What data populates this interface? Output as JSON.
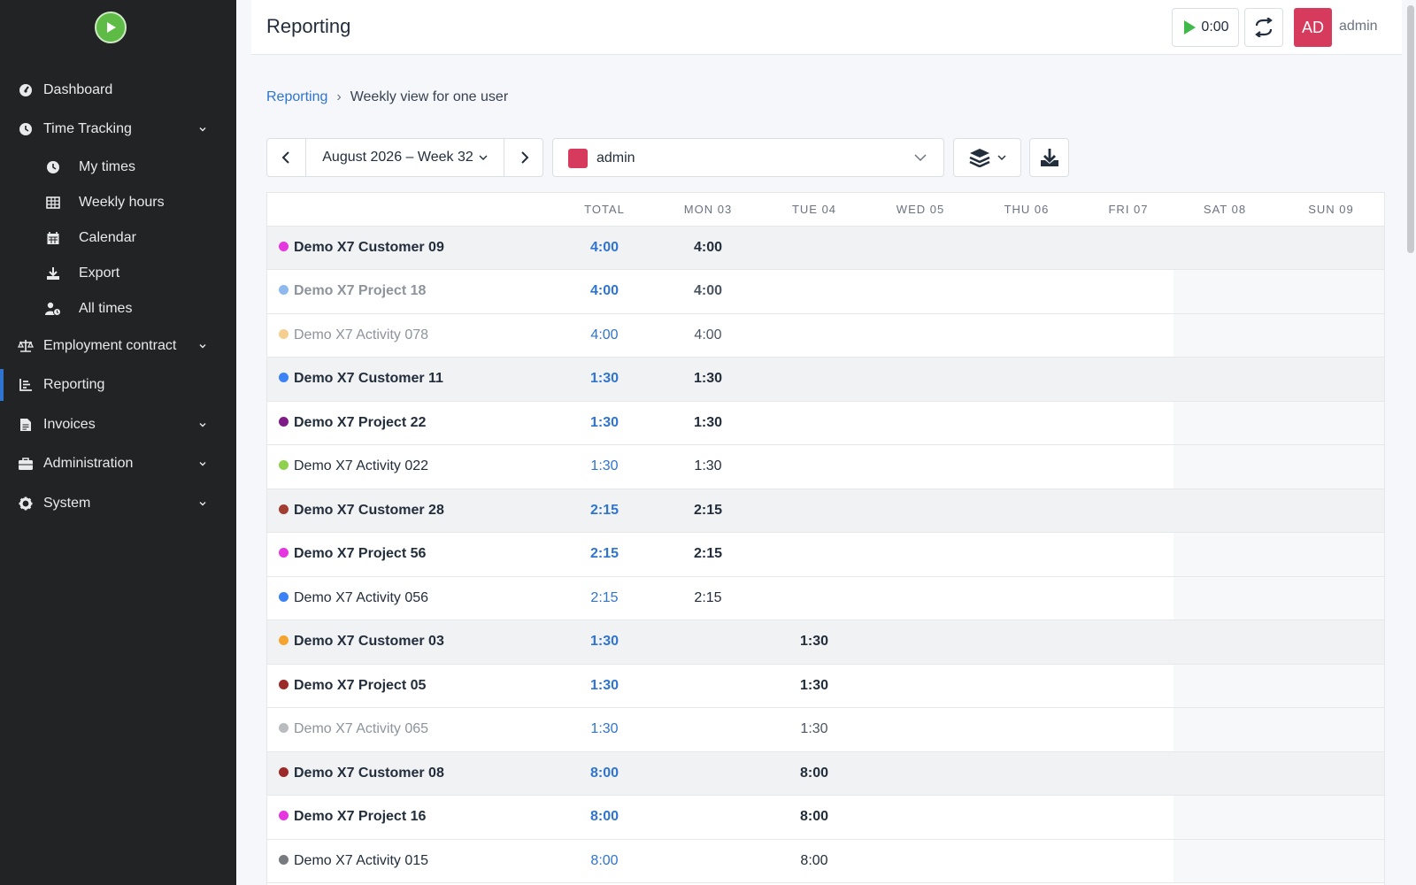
{
  "sidebar": {
    "items": [
      {
        "label": "Dashboard",
        "icon": "dashboard-icon",
        "has_chevron": false
      },
      {
        "label": "Time Tracking",
        "icon": "clock-icon",
        "has_chevron": true
      },
      {
        "label": "My times",
        "icon": "clock-icon",
        "sub": true
      },
      {
        "label": "Weekly hours",
        "icon": "grid-icon",
        "sub": true
      },
      {
        "label": "Calendar",
        "icon": "calendar-icon",
        "sub": true
      },
      {
        "label": "Export",
        "icon": "download-icon",
        "sub": true
      },
      {
        "label": "All times",
        "icon": "user-clock-icon",
        "sub": true
      },
      {
        "label": "Employment contract",
        "icon": "balance-scale-icon",
        "has_chevron": true
      },
      {
        "label": "Reporting",
        "icon": "chart-icon",
        "active": true
      },
      {
        "label": "Invoices",
        "icon": "file-invoice-icon",
        "has_chevron": true
      },
      {
        "label": "Administration",
        "icon": "toolbox-icon",
        "has_chevron": true
      },
      {
        "label": "System",
        "icon": "gear-icon",
        "has_chevron": true
      }
    ]
  },
  "header": {
    "title": "Reporting",
    "timer": "0:00",
    "avatar_initials": "AD",
    "user_name": "admin"
  },
  "breadcrumb": {
    "parent": "Reporting",
    "separator": "›",
    "current": "Weekly view for one user"
  },
  "toolbar": {
    "week_label": "August 2026 – Week 32",
    "user_select_value": "admin",
    "user_color": "#d63b5d"
  },
  "table": {
    "columns": [
      "",
      "TOTAL",
      "MON 03",
      "TUE 04",
      "WED 05",
      "THU 06",
      "FRI 07",
      "SAT 08",
      "SUN 09"
    ],
    "rows": [
      {
        "type": "customer",
        "name": "Demo X7 Customer 09",
        "color": "#e536e0",
        "total": "4:00",
        "days": [
          "4:00",
          "",
          "",
          "",
          "",
          "",
          ""
        ]
      },
      {
        "type": "project",
        "faded": true,
        "name": "Demo X7 Project 18",
        "color": "#8fb8ef",
        "total": "4:00",
        "days": [
          "4:00",
          "",
          "",
          "",
          "",
          "",
          ""
        ]
      },
      {
        "type": "activity",
        "faded": true,
        "name": "Demo X7 Activity 078",
        "color": "#f5cf8f",
        "total": "4:00",
        "days": [
          "4:00",
          "",
          "",
          "",
          "",
          "",
          ""
        ]
      },
      {
        "type": "customer",
        "name": "Demo X7 Customer 11",
        "color": "#3b82f6",
        "total": "1:30",
        "days": [
          "1:30",
          "",
          "",
          "",
          "",
          "",
          ""
        ]
      },
      {
        "type": "project",
        "name": "Demo X7 Project 22",
        "color": "#7e1b86",
        "total": "1:30",
        "days": [
          "1:30",
          "",
          "",
          "",
          "",
          "",
          ""
        ]
      },
      {
        "type": "activity",
        "name": "Demo X7 Activity 022",
        "color": "#8fd14f",
        "total": "1:30",
        "days": [
          "1:30",
          "",
          "",
          "",
          "",
          "",
          ""
        ]
      },
      {
        "type": "customer",
        "name": "Demo X7 Customer 28",
        "color": "#a23d31",
        "total": "2:15",
        "days": [
          "2:15",
          "",
          "",
          "",
          "",
          "",
          ""
        ]
      },
      {
        "type": "project",
        "name": "Demo X7 Project 56",
        "color": "#e536e0",
        "total": "2:15",
        "days": [
          "2:15",
          "",
          "",
          "",
          "",
          "",
          ""
        ]
      },
      {
        "type": "activity",
        "name": "Demo X7 Activity 056",
        "color": "#3b82f6",
        "total": "2:15",
        "days": [
          "2:15",
          "",
          "",
          "",
          "",
          "",
          ""
        ]
      },
      {
        "type": "customer",
        "name": "Demo X7 Customer 03",
        "color": "#f5a52f",
        "total": "1:30",
        "days": [
          "",
          "1:30",
          "",
          "",
          "",
          "",
          ""
        ]
      },
      {
        "type": "project",
        "name": "Demo X7 Project 05",
        "color": "#9c2a28",
        "total": "1:30",
        "days": [
          "",
          "1:30",
          "",
          "",
          "",
          "",
          ""
        ]
      },
      {
        "type": "activity",
        "faded": true,
        "name": "Demo X7 Activity 065",
        "color": "#b9bbbe",
        "total": "1:30",
        "days": [
          "",
          "1:30",
          "",
          "",
          "",
          "",
          ""
        ]
      },
      {
        "type": "customer",
        "name": "Demo X7 Customer 08",
        "color": "#9c2a28",
        "total": "8:00",
        "days": [
          "",
          "8:00",
          "",
          "",
          "",
          "",
          ""
        ]
      },
      {
        "type": "project",
        "name": "Demo X7 Project 16",
        "color": "#e536e0",
        "total": "8:00",
        "days": [
          "",
          "8:00",
          "",
          "",
          "",
          "",
          ""
        ]
      },
      {
        "type": "activity",
        "name": "Demo X7 Activity 015",
        "color": "#777a7e",
        "total": "8:00",
        "days": [
          "",
          "8:00",
          "",
          "",
          "",
          "",
          ""
        ]
      }
    ]
  }
}
